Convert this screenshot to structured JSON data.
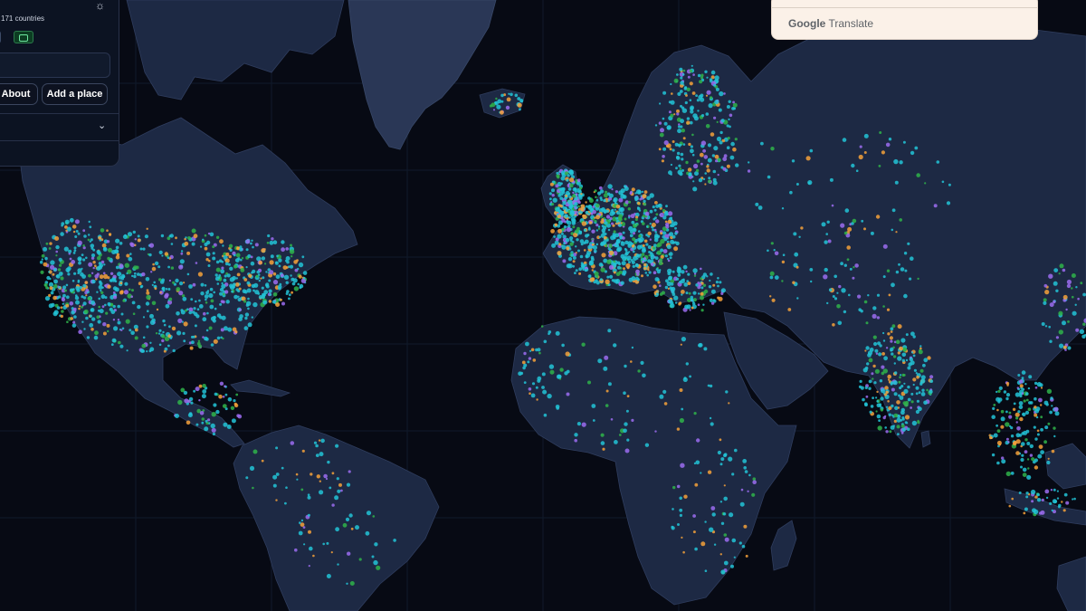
{
  "panel": {
    "stats_text": "171 countries",
    "gear_icon": "gear-icon",
    "about_label": "About",
    "add_place_label": "Add a place",
    "collapse_icon": "chevron-down-icon"
  },
  "translate_widget": {
    "brand": "Google",
    "product": "Translate"
  },
  "colors": {
    "ocean": "#070a14",
    "land": "#1d2944",
    "marker_cyan": "#22c3d6",
    "marker_green": "#2fb34a",
    "marker_orange": "#f5a13a",
    "marker_purple": "#9b6cf0"
  }
}
